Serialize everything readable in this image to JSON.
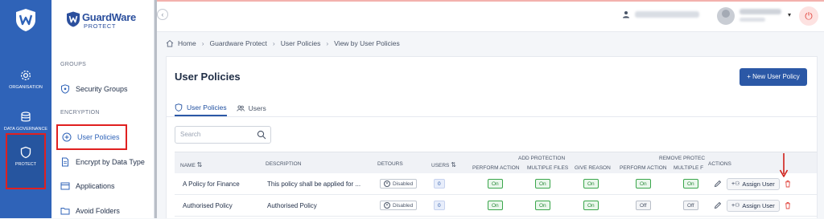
{
  "rail": {
    "items": [
      {
        "label": "ORGANISATION",
        "icon": "gear-icon"
      },
      {
        "label": "DATA GOVERNANCE",
        "icon": "database-icon"
      },
      {
        "label": "PROTECT",
        "icon": "shield-icon"
      }
    ]
  },
  "brand": {
    "name": "GuardWare",
    "sub": "PROTECT"
  },
  "sidebar": {
    "group_groups": "GROUPS",
    "group_encryption": "ENCRYPTION",
    "items": [
      {
        "label": "Security Groups",
        "icon": "shield-icon"
      },
      {
        "label": "User Policies",
        "icon": "plus-circle-icon"
      },
      {
        "label": "Encrypt by Data Type",
        "icon": "file-icon"
      },
      {
        "label": "Applications",
        "icon": "app-window-icon"
      },
      {
        "label": "Avoid Folders",
        "icon": "folder-icon"
      }
    ]
  },
  "breadcrumb": [
    "Home",
    "Guardware Protect",
    "User Policies",
    "View by User Policies"
  ],
  "page": {
    "title": "User Policies",
    "new_button": "+ New User Policy"
  },
  "tabs": [
    "User Policies",
    "Users"
  ],
  "search": {
    "placeholder": "Search"
  },
  "table": {
    "headers": {
      "name": "NAME",
      "description": "DESCRIPTION",
      "detours": "DETOURS",
      "users": "USERS",
      "add_protection": "ADD PROTECTION",
      "remove_protection": "REMOVE PROTEC",
      "actions": "ACTIONS",
      "perform_action": "PERFORM ACTION",
      "multiple_files": "MULTIPLE FILES",
      "give_reason": "GIVE REASON",
      "multiple_f": "MULTIPLE F"
    },
    "rows": [
      {
        "name": "A Policy for Finance",
        "description": "This policy shall be applied for ...",
        "detours": "Disabled",
        "users": "0",
        "add_perform": "On",
        "add_multi": "On",
        "add_reason": "On",
        "rem_perform": "On",
        "rem_multi": "On",
        "assign": "Assign User"
      },
      {
        "name": "Authorised Policy",
        "description": "Authorised Policy",
        "detours": "Disabled",
        "users": "0",
        "add_perform": "On",
        "add_multi": "On",
        "add_reason": "On",
        "rem_perform": "Off",
        "rem_multi": "Off",
        "assign": "Assign User"
      }
    ]
  },
  "colors": {
    "rail": "#2f63b8",
    "primary": "#2b58a6",
    "highlight": "#e02020",
    "on": "#3aa64b"
  }
}
